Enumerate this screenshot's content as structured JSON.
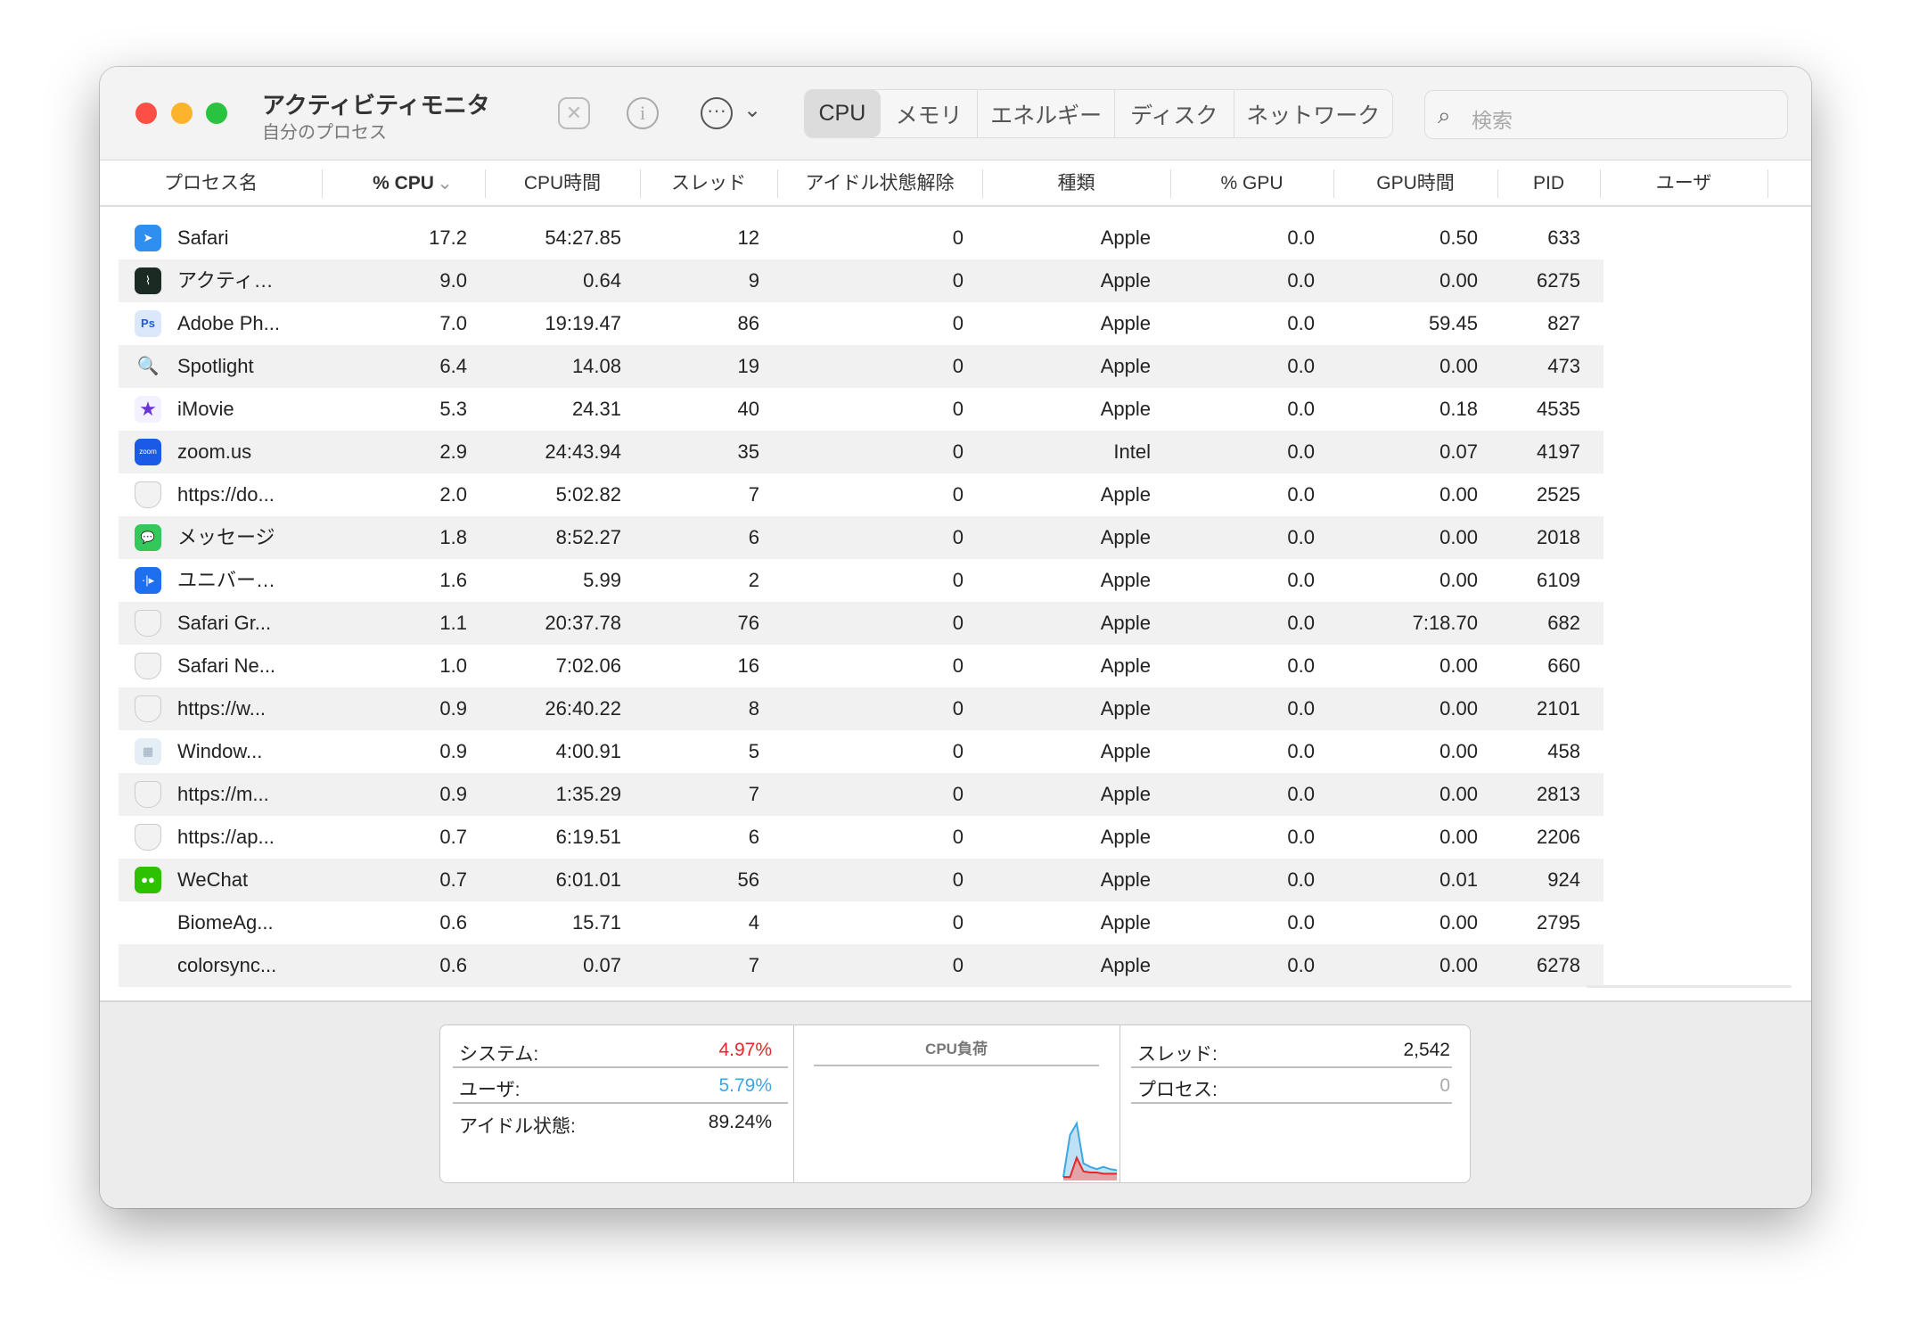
{
  "window": {
    "title": "アクティビティモニタ",
    "subtitle": "自分のプロセス"
  },
  "toolbar": {
    "stop_icon": "x-octagon-icon",
    "info_icon": "info-icon",
    "more_icon": "ellipsis-circle-icon",
    "more_chevron": "⌄",
    "tabs": [
      {
        "label": "CPU",
        "active": true
      },
      {
        "label": "メモリ"
      },
      {
        "label": "エネルギー"
      },
      {
        "label": "ディスク"
      },
      {
        "label": "ネットワーク"
      }
    ],
    "search_placeholder": "検索"
  },
  "columns": [
    "プロセス名",
    "% CPU",
    "CPU時間",
    "スレッド",
    "アイドル状態解除",
    "種類",
    "% GPU",
    "GPU時間",
    "PID",
    "ユーザ"
  ],
  "sort_column": "% CPU",
  "sort_direction": "descending",
  "processes": [
    {
      "icon": "safari",
      "name": "Safari",
      "cpu": "17.2",
      "cpu_time": "54:27.85",
      "threads": "12",
      "idle_wakeups": "0",
      "kind": "Apple",
      "gpu": "0.0",
      "gpu_time": "0.50",
      "pid": "633"
    },
    {
      "icon": "activity-monitor",
      "name": "アクティ…",
      "cpu": "9.0",
      "cpu_time": "0.64",
      "threads": "9",
      "idle_wakeups": "0",
      "kind": "Apple",
      "gpu": "0.0",
      "gpu_time": "0.00",
      "pid": "6275"
    },
    {
      "icon": "photoshop",
      "name": "Adobe Ph...",
      "cpu": "7.0",
      "cpu_time": "19:19.47",
      "threads": "86",
      "idle_wakeups": "0",
      "kind": "Apple",
      "gpu": "0.0",
      "gpu_time": "59.45",
      "pid": "827"
    },
    {
      "icon": "spotlight",
      "name": "Spotlight",
      "cpu": "6.4",
      "cpu_time": "14.08",
      "threads": "19",
      "idle_wakeups": "0",
      "kind": "Apple",
      "gpu": "0.0",
      "gpu_time": "0.00",
      "pid": "473"
    },
    {
      "icon": "imovie",
      "name": "iMovie",
      "cpu": "5.3",
      "cpu_time": "24.31",
      "threads": "40",
      "idle_wakeups": "0",
      "kind": "Apple",
      "gpu": "0.0",
      "gpu_time": "0.18",
      "pid": "4535"
    },
    {
      "icon": "zoom",
      "name": "zoom.us",
      "cpu": "2.9",
      "cpu_time": "24:43.94",
      "threads": "35",
      "idle_wakeups": "0",
      "kind": "Intel",
      "gpu": "0.0",
      "gpu_time": "0.07",
      "pid": "4197"
    },
    {
      "icon": "shield",
      "name": "https://do...",
      "cpu": "2.0",
      "cpu_time": "5:02.82",
      "threads": "7",
      "idle_wakeups": "0",
      "kind": "Apple",
      "gpu": "0.0",
      "gpu_time": "0.00",
      "pid": "2525"
    },
    {
      "icon": "messages",
      "name": "メッセージ",
      "cpu": "1.8",
      "cpu_time": "8:52.27",
      "threads": "6",
      "idle_wakeups": "0",
      "kind": "Apple",
      "gpu": "0.0",
      "gpu_time": "0.00",
      "pid": "2018"
    },
    {
      "icon": "universal-control",
      "name": "ユニバー…",
      "cpu": "1.6",
      "cpu_time": "5.99",
      "threads": "2",
      "idle_wakeups": "0",
      "kind": "Apple",
      "gpu": "0.0",
      "gpu_time": "0.00",
      "pid": "6109"
    },
    {
      "icon": "shield",
      "name": "Safari Gr...",
      "cpu": "1.1",
      "cpu_time": "20:37.78",
      "threads": "76",
      "idle_wakeups": "0",
      "kind": "Apple",
      "gpu": "0.0",
      "gpu_time": "7:18.70",
      "pid": "682"
    },
    {
      "icon": "shield",
      "name": "Safari Ne...",
      "cpu": "1.0",
      "cpu_time": "7:02.06",
      "threads": "16",
      "idle_wakeups": "0",
      "kind": "Apple",
      "gpu": "0.0",
      "gpu_time": "0.00",
      "pid": "660"
    },
    {
      "icon": "shield",
      "name": "https://w...",
      "cpu": "0.9",
      "cpu_time": "26:40.22",
      "threads": "8",
      "idle_wakeups": "0",
      "kind": "Apple",
      "gpu": "0.0",
      "gpu_time": "0.00",
      "pid": "2101"
    },
    {
      "icon": "window-server",
      "name": "Window...",
      "cpu": "0.9",
      "cpu_time": "4:00.91",
      "threads": "5",
      "idle_wakeups": "0",
      "kind": "Apple",
      "gpu": "0.0",
      "gpu_time": "0.00",
      "pid": "458"
    },
    {
      "icon": "shield",
      "name": "https://m...",
      "cpu": "0.9",
      "cpu_time": "1:35.29",
      "threads": "7",
      "idle_wakeups": "0",
      "kind": "Apple",
      "gpu": "0.0",
      "gpu_time": "0.00",
      "pid": "2813"
    },
    {
      "icon": "shield",
      "name": "https://ap...",
      "cpu": "0.7",
      "cpu_time": "6:19.51",
      "threads": "6",
      "idle_wakeups": "0",
      "kind": "Apple",
      "gpu": "0.0",
      "gpu_time": "0.00",
      "pid": "2206"
    },
    {
      "icon": "wechat",
      "name": "WeChat",
      "cpu": "0.7",
      "cpu_time": "6:01.01",
      "threads": "56",
      "idle_wakeups": "0",
      "kind": "Apple",
      "gpu": "0.0",
      "gpu_time": "0.01",
      "pid": "924"
    },
    {
      "icon": "",
      "name": "BiomeAg...",
      "cpu": "0.6",
      "cpu_time": "15.71",
      "threads": "4",
      "idle_wakeups": "0",
      "kind": "Apple",
      "gpu": "0.0",
      "gpu_time": "0.00",
      "pid": "2795"
    },
    {
      "icon": "",
      "name": "colorsync...",
      "cpu": "0.6",
      "cpu_time": "0.07",
      "threads": "7",
      "idle_wakeups": "0",
      "kind": "Apple",
      "gpu": "0.0",
      "gpu_time": "0.00",
      "pid": "6278"
    }
  ],
  "summary": {
    "system_label": "システム:",
    "system_value": "4.97%",
    "system_color": "#e8262b",
    "user_label": "ユーザ:",
    "user_value": "5.79%",
    "user_color": "#3ea6e0",
    "idle_label": "アイドル状態:",
    "idle_value": "89.24%",
    "chart_title": "CPU負荷",
    "threads_label": "スレッド:",
    "threads_value": "2,542",
    "processes_label": "プロセス:",
    "processes_value": "0"
  },
  "cpu_load_history": {
    "system": [
      3,
      3,
      20,
      8,
      7,
      7,
      6,
      6,
      6
    ],
    "total": [
      3,
      40,
      50,
      15,
      12,
      10,
      12,
      10,
      9
    ]
  }
}
